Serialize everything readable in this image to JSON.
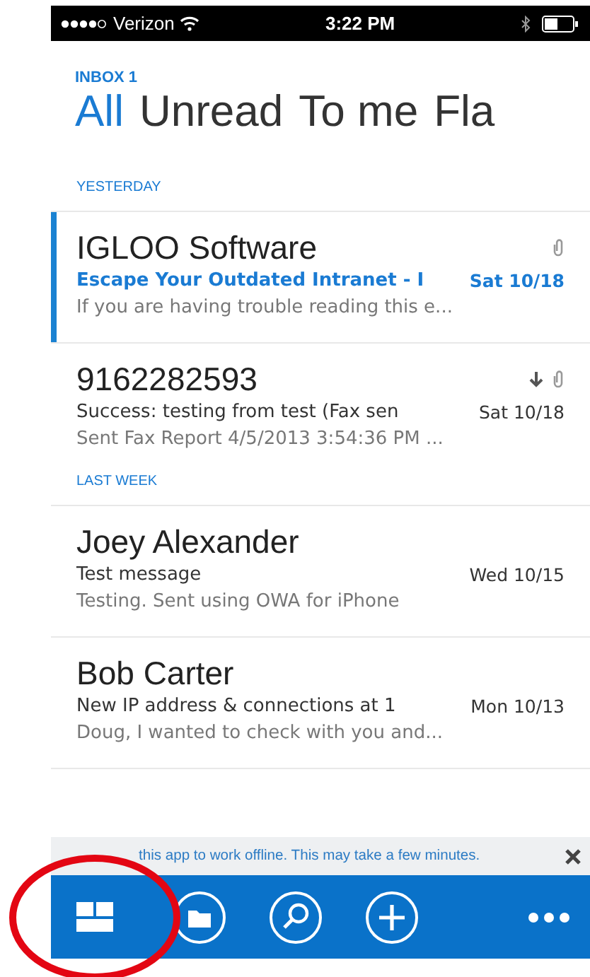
{
  "status_bar": {
    "carrier": "Verizon",
    "time": "3:22 PM"
  },
  "header": {
    "folder": "INBOX 1",
    "tabs": [
      {
        "label": "All",
        "selected": true
      },
      {
        "label": "Unread",
        "selected": false
      },
      {
        "label": "To me",
        "selected": false
      },
      {
        "label": "Fla",
        "selected": false
      }
    ]
  },
  "sections": [
    {
      "title": "YESTERDAY",
      "messages": [
        {
          "sender": "IGLOO Software",
          "subject": "Escape Your Outdated Intranet - I",
          "date": "Sat 10/18",
          "preview": "If you are having trouble reading this e...",
          "unread": true,
          "selected": true,
          "icons": [
            {
              "kind": "attachment"
            }
          ]
        },
        {
          "sender": "9162282593",
          "subject": "Success: testing from test (Fax sen",
          "date": "Sat 10/18",
          "preview": "Sent Fax Report 4/5/2013 3:54:36 PM  ...",
          "unread": false,
          "selected": false,
          "icons": [
            {
              "kind": "low_importance"
            },
            {
              "kind": "attachment"
            }
          ]
        }
      ]
    },
    {
      "title": "LAST WEEK",
      "messages": [
        {
          "sender": "Joey Alexander",
          "subject": "Test message",
          "date": "Wed 10/15",
          "preview": "Testing.  Sent using OWA for iPhone",
          "unread": false,
          "selected": false
        },
        {
          "sender": "Bob Carter",
          "subject": "New IP address & connections at 1",
          "date": "Mon 10/13",
          "preview": "Doug,   I wanted to check with you and...",
          "unread": false,
          "selected": false
        }
      ]
    }
  ],
  "banner": {
    "text": "this app to work offline. This may take a few minutes."
  },
  "toolbar": [
    {
      "kind": "tiles"
    },
    {
      "kind": "folder"
    },
    {
      "kind": "search"
    },
    {
      "kind": "add"
    },
    {
      "kind": "more"
    }
  ]
}
